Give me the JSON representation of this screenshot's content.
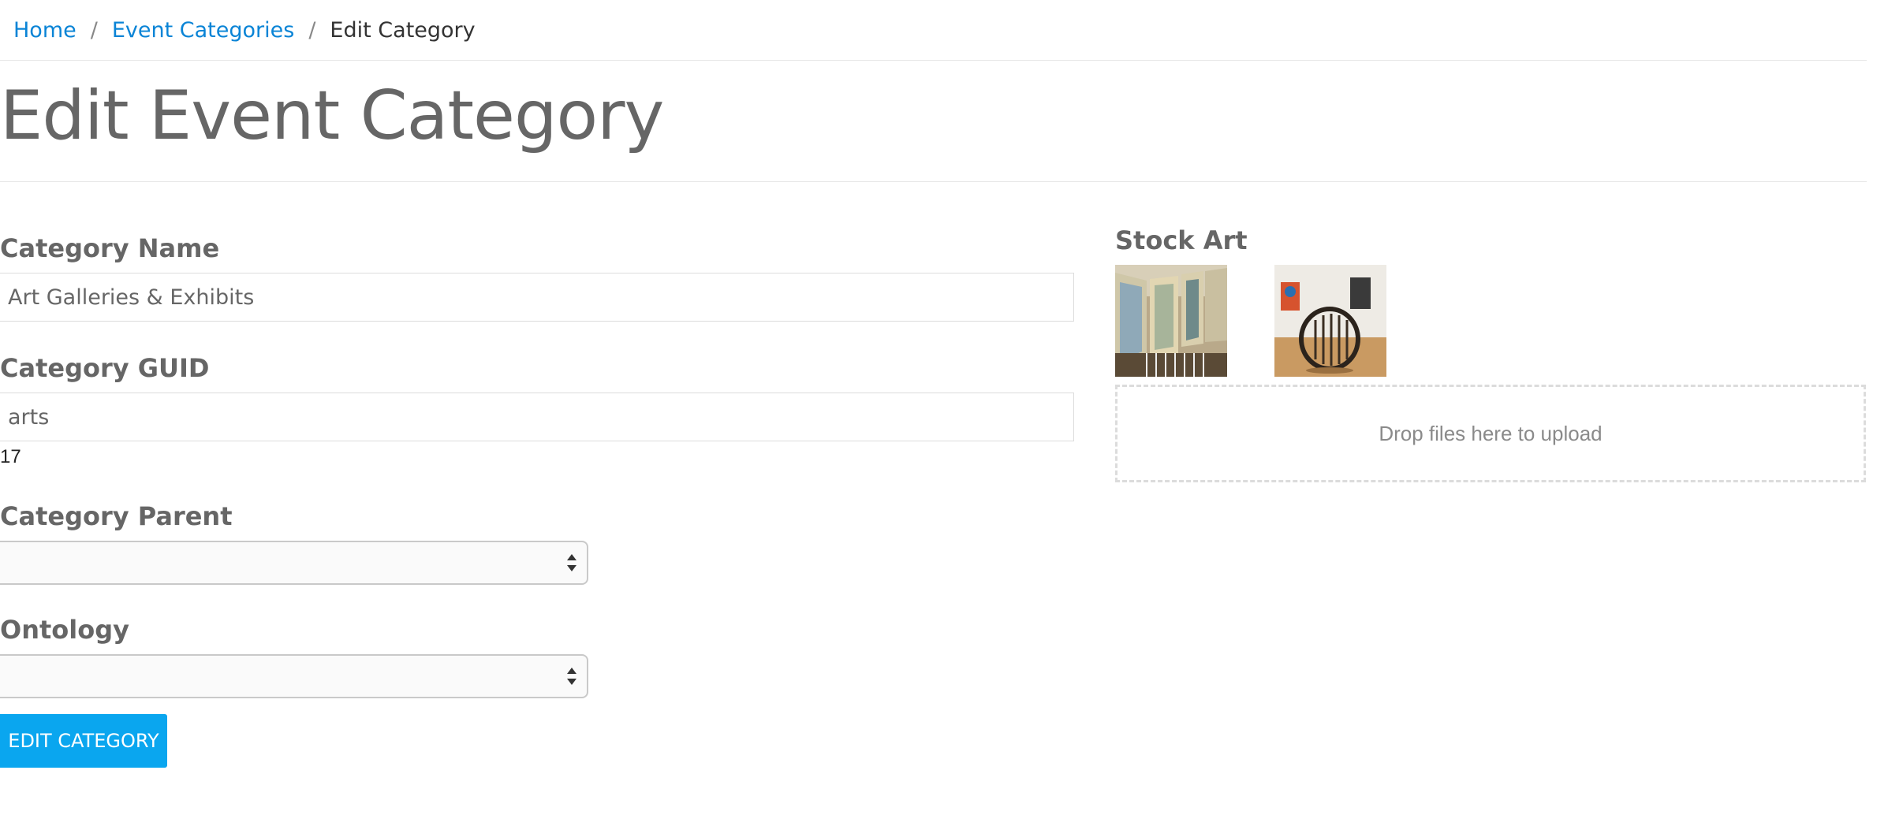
{
  "breadcrumb": {
    "items": [
      {
        "label": "Home",
        "link": true
      },
      {
        "label": "Event Categories",
        "link": true
      },
      {
        "label": "Edit Category",
        "link": false
      }
    ],
    "separator": "/"
  },
  "page_title": "Edit Event Category",
  "form": {
    "name": {
      "label": "Category Name",
      "value": "Art Galleries & Exhibits"
    },
    "guid": {
      "label": "Category GUID",
      "value": "arts"
    },
    "id_value": "17",
    "parent": {
      "label": "Category Parent",
      "selected": ""
    },
    "ontology": {
      "label": "Ontology",
      "selected": ""
    },
    "submit_label": "EDIT CATEGORY"
  },
  "stock_art": {
    "label": "Stock Art",
    "thumbnails": [
      {
        "name": "gallery-paintings-thumbnail"
      },
      {
        "name": "circular-sculpture-thumbnail"
      }
    ],
    "dropzone_text": "Drop files here to upload"
  },
  "colors": {
    "link": "#0a84d6",
    "button": "#0aa6ef",
    "heading": "#666666"
  }
}
